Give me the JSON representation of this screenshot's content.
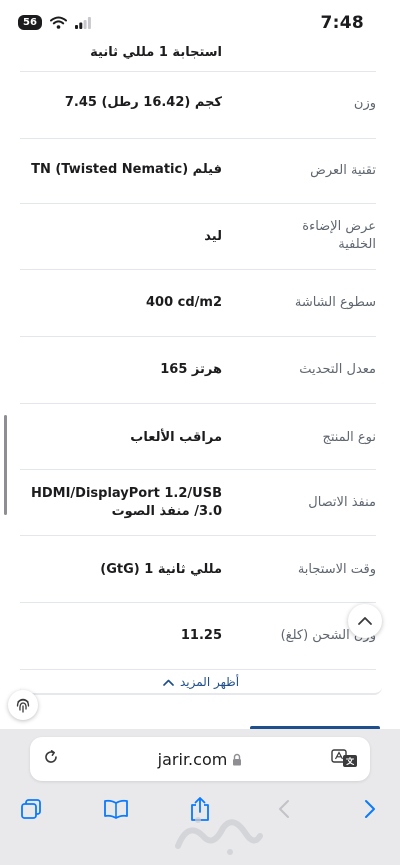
{
  "status_bar": {
    "battery": "56",
    "time": "7:48"
  },
  "specs": [
    {
      "label": "",
      "value": "استجابة 1 مللي ثانية"
    },
    {
      "label": "وزن",
      "value": "كجم (16.42 رطل) 7.45"
    },
    {
      "label": "تقنية العرض",
      "value": "فيلم TN (Twisted Nematic)"
    },
    {
      "label": "عرض الإضاءة الخلفية",
      "value": "ليد"
    },
    {
      "label": "سطوع الشاشة",
      "value": "400 cd/m2"
    },
    {
      "label": "معدل التحديث",
      "value": "هرتز 165"
    },
    {
      "label": "نوع المنتج",
      "value": "مراقب الألعاب"
    },
    {
      "label": "منفذ الاتصال",
      "value": "HDMI/DisplayPort 1.2/USB 3.0/ منفذ الصوت"
    },
    {
      "label": "وقت الاستجابة",
      "value": "مللي ثانية 1 (GtG)"
    },
    {
      "label": "وزن الشحن (كلغ)",
      "value": "11.25"
    }
  ],
  "show_more": {
    "label": "أظهر المزيد"
  },
  "browser": {
    "url": "jarir.com"
  },
  "icons": {
    "reload": "reload-icon",
    "lock": "lock-icon",
    "translate": "translate-icon",
    "tabs": "tabs-icon",
    "bookmarks": "book-icon",
    "share": "share-icon",
    "back": "chevron-left-icon",
    "forward": "chevron-right-icon",
    "scroll_top": "chevron-up-icon",
    "fingerprint": "fingerprint-icon"
  },
  "colors": {
    "accent": "#1f4e8c",
    "ios_blue": "#0a7aff",
    "label_gray": "#5f6670",
    "browser_bar": "#e9e9eb"
  }
}
